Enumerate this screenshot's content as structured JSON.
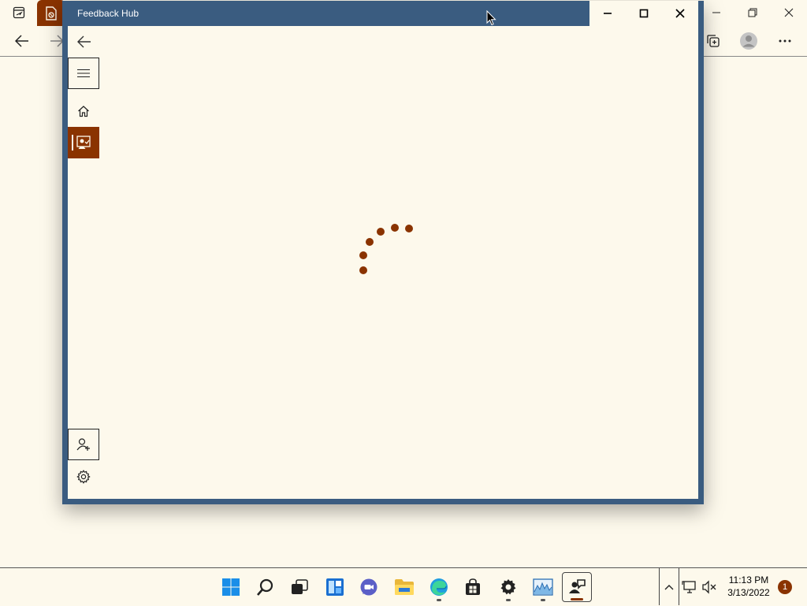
{
  "app": {
    "title": "Feedback Hub",
    "nav_items": [
      "Back",
      "Navigation menu",
      "Home",
      "Feedback",
      "Sign in",
      "Settings"
    ]
  },
  "window_controls": [
    "minimize",
    "maximize",
    "close"
  ],
  "loading": {
    "type": "progress-ring",
    "dot_color": "#8a3300"
  },
  "background_browser": {
    "toolbar_icons": [
      "back-icon",
      "forward-icon",
      "collections-icon",
      "profile-icon",
      "more-icon"
    ]
  },
  "taskbar": {
    "apps": [
      "Start",
      "Search",
      "Task View",
      "Widgets",
      "Chat",
      "File Explorer",
      "Microsoft Edge",
      "Microsoft Store",
      "Settings",
      "Performance Monitor",
      "Feedback Hub"
    ],
    "clock": {
      "time": "11:13 PM",
      "date": "3/13/2022"
    },
    "notification_count": "1"
  },
  "colors": {
    "accent": "#8a3300",
    "titlebar": "#3a5c80",
    "background": "#fdf9ec"
  }
}
